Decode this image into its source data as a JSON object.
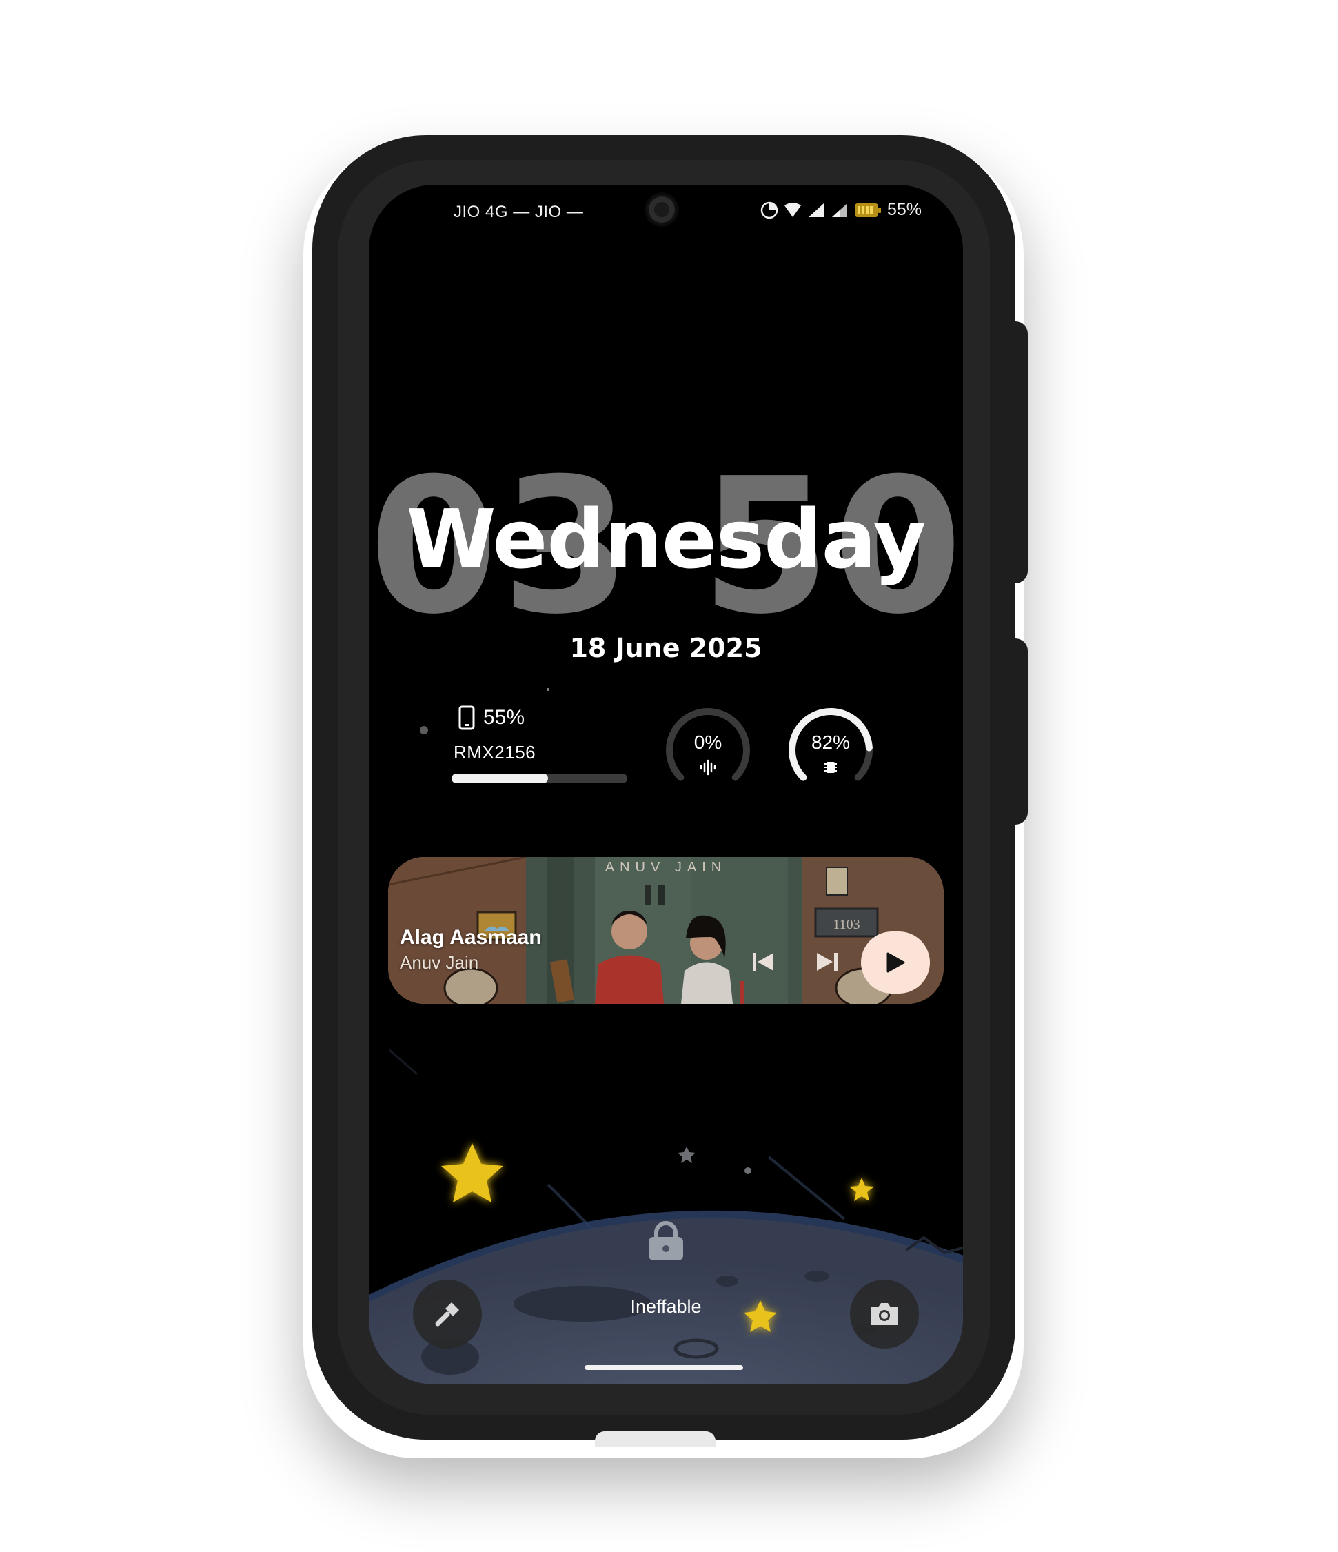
{
  "status_bar": {
    "carrier": "JIO 4G — JIO — ",
    "battery": "55%"
  },
  "lockscreen": {
    "clock": "03 50",
    "day": "Wednesday",
    "date": "18 June 2025",
    "owner_info": "Ineffable"
  },
  "battery_widget": {
    "percent": "55%",
    "level": 0.55,
    "device": "RMX2156"
  },
  "gauges": [
    {
      "label": "0%",
      "value": 0,
      "icon": "sound-wave-icon"
    },
    {
      "label": "82%",
      "value": 82,
      "icon": "cpu-chip-icon"
    }
  ],
  "music": {
    "album_banner": "ANUV JAIN",
    "room_number": "1103",
    "title": "Alag Aasmaan",
    "artist": "Anuv Jain"
  },
  "colors": {
    "accent_play": "#fbe3d8",
    "star": "#e9c21a",
    "moon": "#3c4456"
  }
}
